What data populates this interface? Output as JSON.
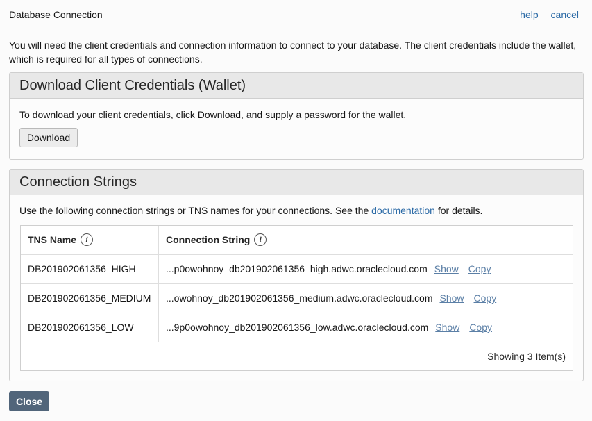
{
  "dialog": {
    "title": "Database Connection",
    "help_link": "help",
    "cancel_link": "cancel",
    "intro": "You will need the client credentials and connection information to connect to your database. The client credentials include the wallet, which is required for all types of connections."
  },
  "wallet_section": {
    "heading": "Download Client Credentials (Wallet)",
    "description": "To download your client credentials, click Download, and supply a password for the wallet.",
    "download_label": "Download"
  },
  "connection_section": {
    "heading": "Connection Strings",
    "description_before": "Use the following connection strings or TNS names for your connections. See the ",
    "doc_link": "documentation",
    "description_after": " for details.",
    "table": {
      "columns": [
        "TNS Name",
        "Connection String"
      ],
      "info_glyph": "i",
      "rows": [
        {
          "tns": "DB201902061356_HIGH",
          "conn": "...p0owohnoy_db201902061356_high.adwc.oraclecloud.com",
          "show": "Show",
          "copy": "Copy"
        },
        {
          "tns": "DB201902061356_MEDIUM",
          "conn": "...owohnoy_db201902061356_medium.adwc.oraclecloud.com",
          "show": "Show",
          "copy": "Copy"
        },
        {
          "tns": "DB201902061356_LOW",
          "conn": "...9p0owohnoy_db201902061356_low.adwc.oraclecloud.com",
          "show": "Show",
          "copy": "Copy"
        }
      ],
      "footer": "Showing 3 Item(s)"
    }
  },
  "close_label": "Close",
  "colors": {
    "link": "#2b6aa6",
    "close_button": "#51657a",
    "panel_header": "#e8e8e8"
  },
  "icons": [
    "info-icon"
  ]
}
